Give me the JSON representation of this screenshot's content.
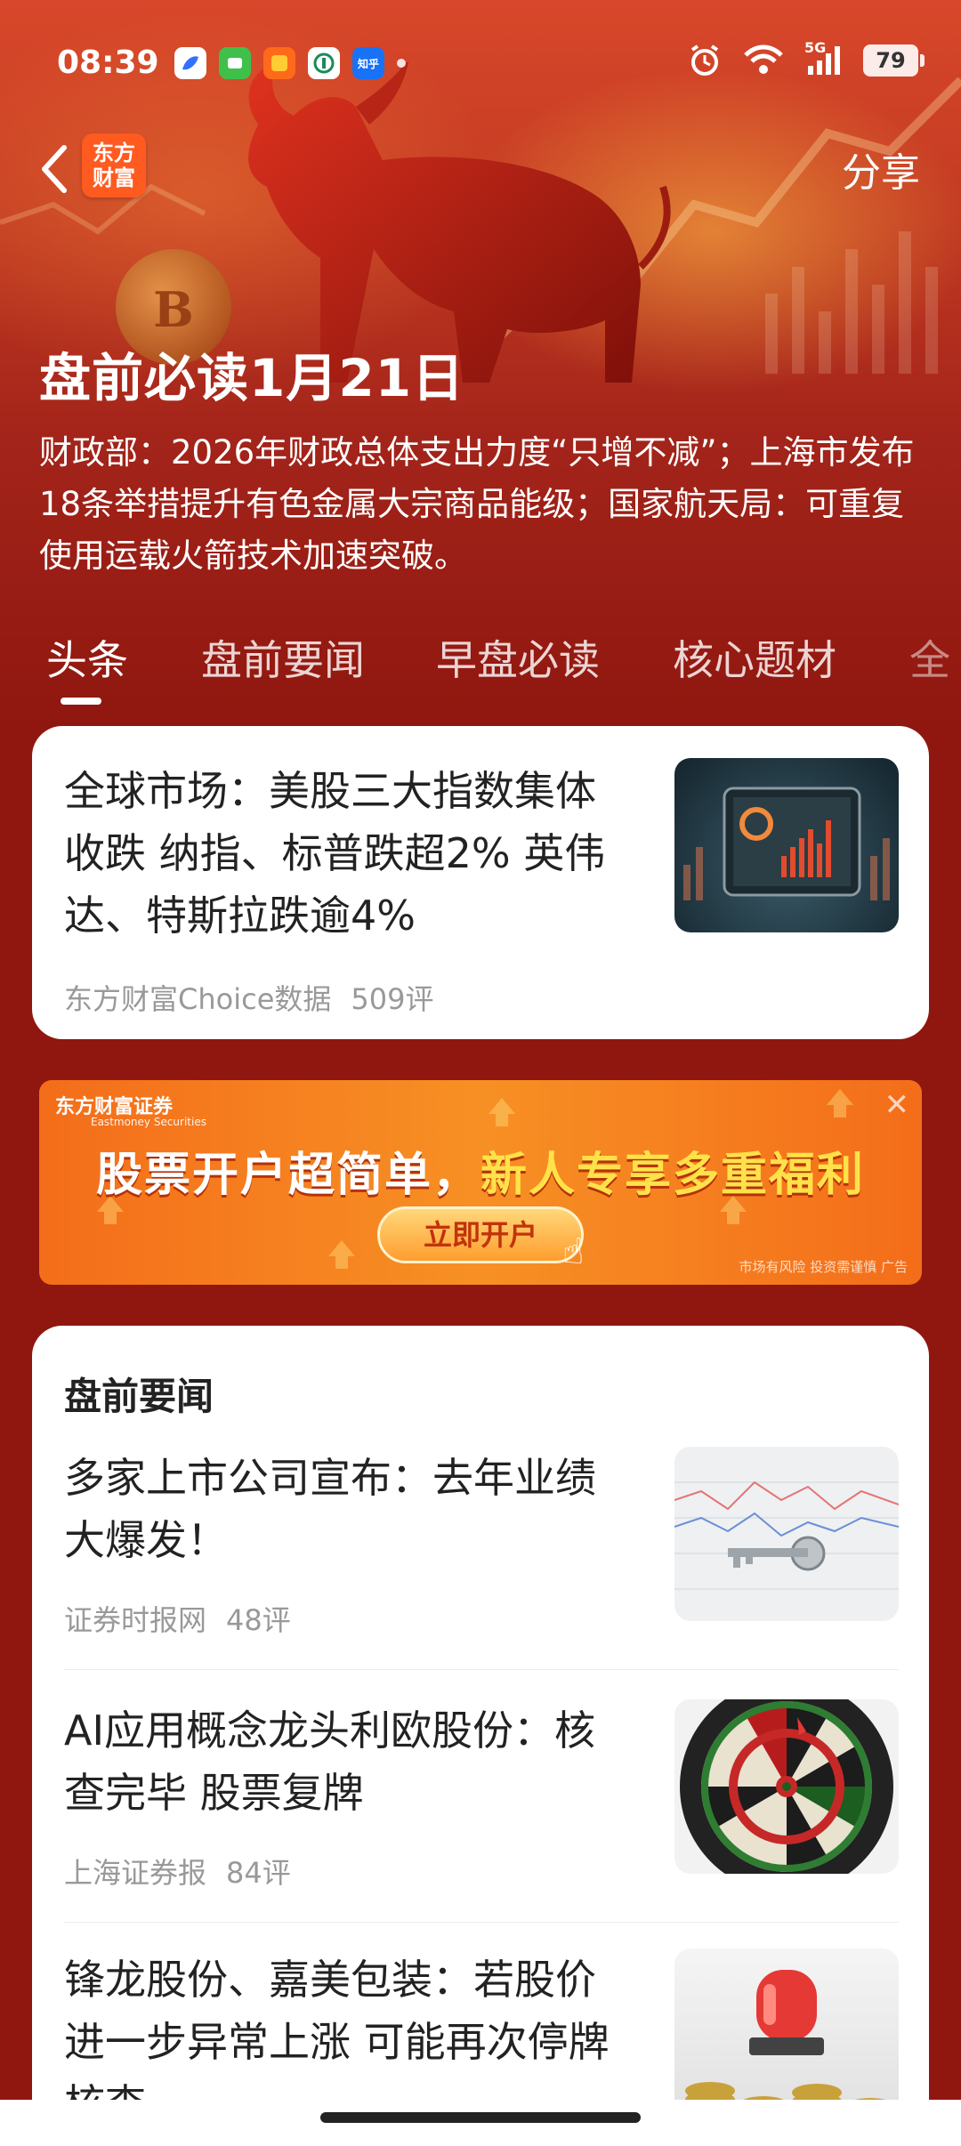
{
  "status_bar": {
    "time": "08:39",
    "notification_icons": [
      "lark-icon",
      "wechat-icon",
      "taobao-icon",
      "bank-icon",
      "zhihu-icon"
    ],
    "zhihu_label": "知乎",
    "network": "5G",
    "battery": "79"
  },
  "nav": {
    "logo_line1": "东方",
    "logo_line2": "财富",
    "share_label": "分享"
  },
  "hero": {
    "coin_symbol": "B",
    "title": "盘前必读1月21日",
    "summary": "财政部：2026年财政总体支出力度“只增不减”；上海市发布18条举措提升有色金属大宗商品能级；国家航天局：可重复使用运载火箭技术加速突破。"
  },
  "tabs": [
    {
      "label": "头条",
      "active": true
    },
    {
      "label": "盘前要闻",
      "active": false
    },
    {
      "label": "早盘必读",
      "active": false
    },
    {
      "label": "核心题材",
      "active": false
    },
    {
      "label": "全",
      "active": false
    }
  ],
  "top_article": {
    "title": "全球市场：美股三大指数集体收跌 纳指、标普跌超2% 英伟达、特斯拉跌逾4%",
    "source": "东方财富Choice数据",
    "comments": "509评"
  },
  "ad": {
    "brand": "东方财富证券",
    "brand_en": "Eastmoney Securities",
    "headline_part1": "股票开户超简单，",
    "headline_part2": "新人专享多重福利",
    "cta": "立即开户",
    "disclaimer": "市场有风险 投资需谨慎 广告"
  },
  "section": {
    "title": "盘前要闻",
    "items": [
      {
        "title": "多家上市公司宣布：去年业绩大爆发！",
        "source": "证券时报网",
        "comments": "48评"
      },
      {
        "title": "AI应用概念龙头利欧股份：核查完毕 股票复牌",
        "source": "上海证券报",
        "comments": "84评"
      },
      {
        "title": "锋龙股份、嘉美包装：若股价进一步异常上涨 可能再次停牌核查",
        "source": "",
        "comments": ""
      }
    ]
  },
  "colors": {
    "page_bg": "#8f170f",
    "brand_orange": "#ff5a1f",
    "ad_orange": "#f79024",
    "ad_highlight": "#ffe24a"
  }
}
